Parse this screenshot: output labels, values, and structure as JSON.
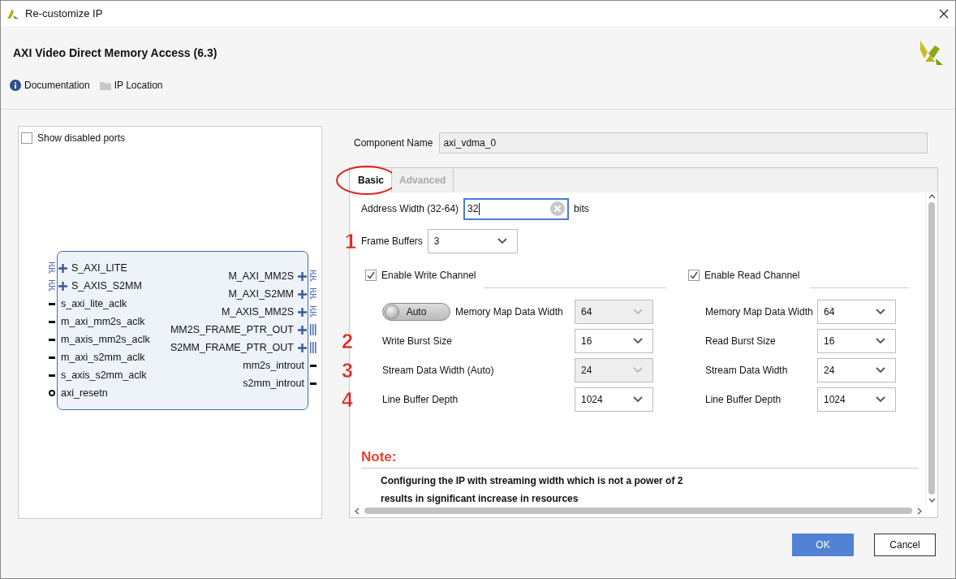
{
  "window": {
    "title": "Re-customize IP"
  },
  "header": {
    "title": "AXI Video Direct Memory Access (6.3)",
    "links": [
      {
        "kind": "info",
        "label": "Documentation"
      },
      {
        "kind": "folder",
        "label": "IP Location"
      }
    ]
  },
  "diagram": {
    "show_disabled_ports": {
      "label": "Show disabled ports",
      "checked": false
    },
    "left_pins": [
      {
        "kind": "bus",
        "label": "S_AXI_LITE"
      },
      {
        "kind": "bus",
        "label": "S_AXIS_S2MM"
      },
      {
        "kind": "clock",
        "label": "s_axi_lite_aclk"
      },
      {
        "kind": "clock",
        "label": "m_axi_mm2s_aclk"
      },
      {
        "kind": "clock",
        "label": "m_axis_mm2s_aclk"
      },
      {
        "kind": "clock",
        "label": "m_axi_s2mm_aclk"
      },
      {
        "kind": "clock",
        "label": "s_axis_s2mm_aclk"
      },
      {
        "kind": "reset",
        "label": "axi_resetn"
      }
    ],
    "right_pins": [
      {
        "kind": "bus",
        "label": "M_AXI_MM2S"
      },
      {
        "kind": "bus",
        "label": "M_AXI_S2MM"
      },
      {
        "kind": "bus",
        "label": "M_AXIS_MM2S"
      },
      {
        "kind": "vector",
        "label": "MM2S_FRAME_PTR_OUT"
      },
      {
        "kind": "vector",
        "label": "S2MM_FRAME_PTR_OUT"
      },
      {
        "kind": "wire",
        "label": "mm2s_introut"
      },
      {
        "kind": "wire",
        "label": "s2mm_introut"
      }
    ]
  },
  "component_name": {
    "label": "Component Name",
    "value": "axi_vdma_0"
  },
  "tabs": [
    {
      "label": "Basic",
      "selected": true,
      "circled": true
    },
    {
      "label": "Advanced",
      "selected": false,
      "circled": false
    }
  ],
  "address_width": {
    "label": "Address Width (32-64)",
    "value": "32",
    "unit": "bits"
  },
  "frame_buffers": {
    "annotation": "1",
    "label": "Frame Buffers",
    "value": "3"
  },
  "channels": [
    {
      "label": "Enable Write Channel",
      "checked": true,
      "rows": [
        {
          "kind": "toggle",
          "toggle": {
            "label": "Auto",
            "on": false
          },
          "label": "Memory Map Data Width",
          "value": "64",
          "disabled": true
        },
        {
          "kind": "select",
          "annotation": "2",
          "label": "Write Burst Size",
          "value": "16",
          "disabled": false
        },
        {
          "kind": "select",
          "annotation": "3",
          "label": "Stream Data Width (Auto)",
          "value": "24",
          "disabled": true
        },
        {
          "kind": "select",
          "annotation": "4",
          "label": "Line Buffer Depth",
          "value": "1024",
          "disabled": false
        }
      ]
    },
    {
      "label": "Enable Read Channel",
      "checked": true,
      "rows": [
        {
          "kind": "select",
          "label": "Memory Map Data Width",
          "value": "64",
          "disabled": false
        },
        {
          "kind": "select",
          "label": "Read Burst Size",
          "value": "16",
          "disabled": false
        },
        {
          "kind": "select",
          "label": "Stream Data Width",
          "value": "24",
          "disabled": false
        },
        {
          "kind": "select",
          "label": "Line Buffer Depth",
          "value": "1024",
          "disabled": false
        }
      ]
    }
  ],
  "note": {
    "title": "Note:",
    "lines": [
      "Configuring the IP with streaming width which is not a power of 2",
      "results in significant increase in resources"
    ]
  },
  "buttons": [
    {
      "kind": "primary",
      "label": "OK"
    },
    {
      "kind": "secondary",
      "label": "Cancel"
    }
  ]
}
